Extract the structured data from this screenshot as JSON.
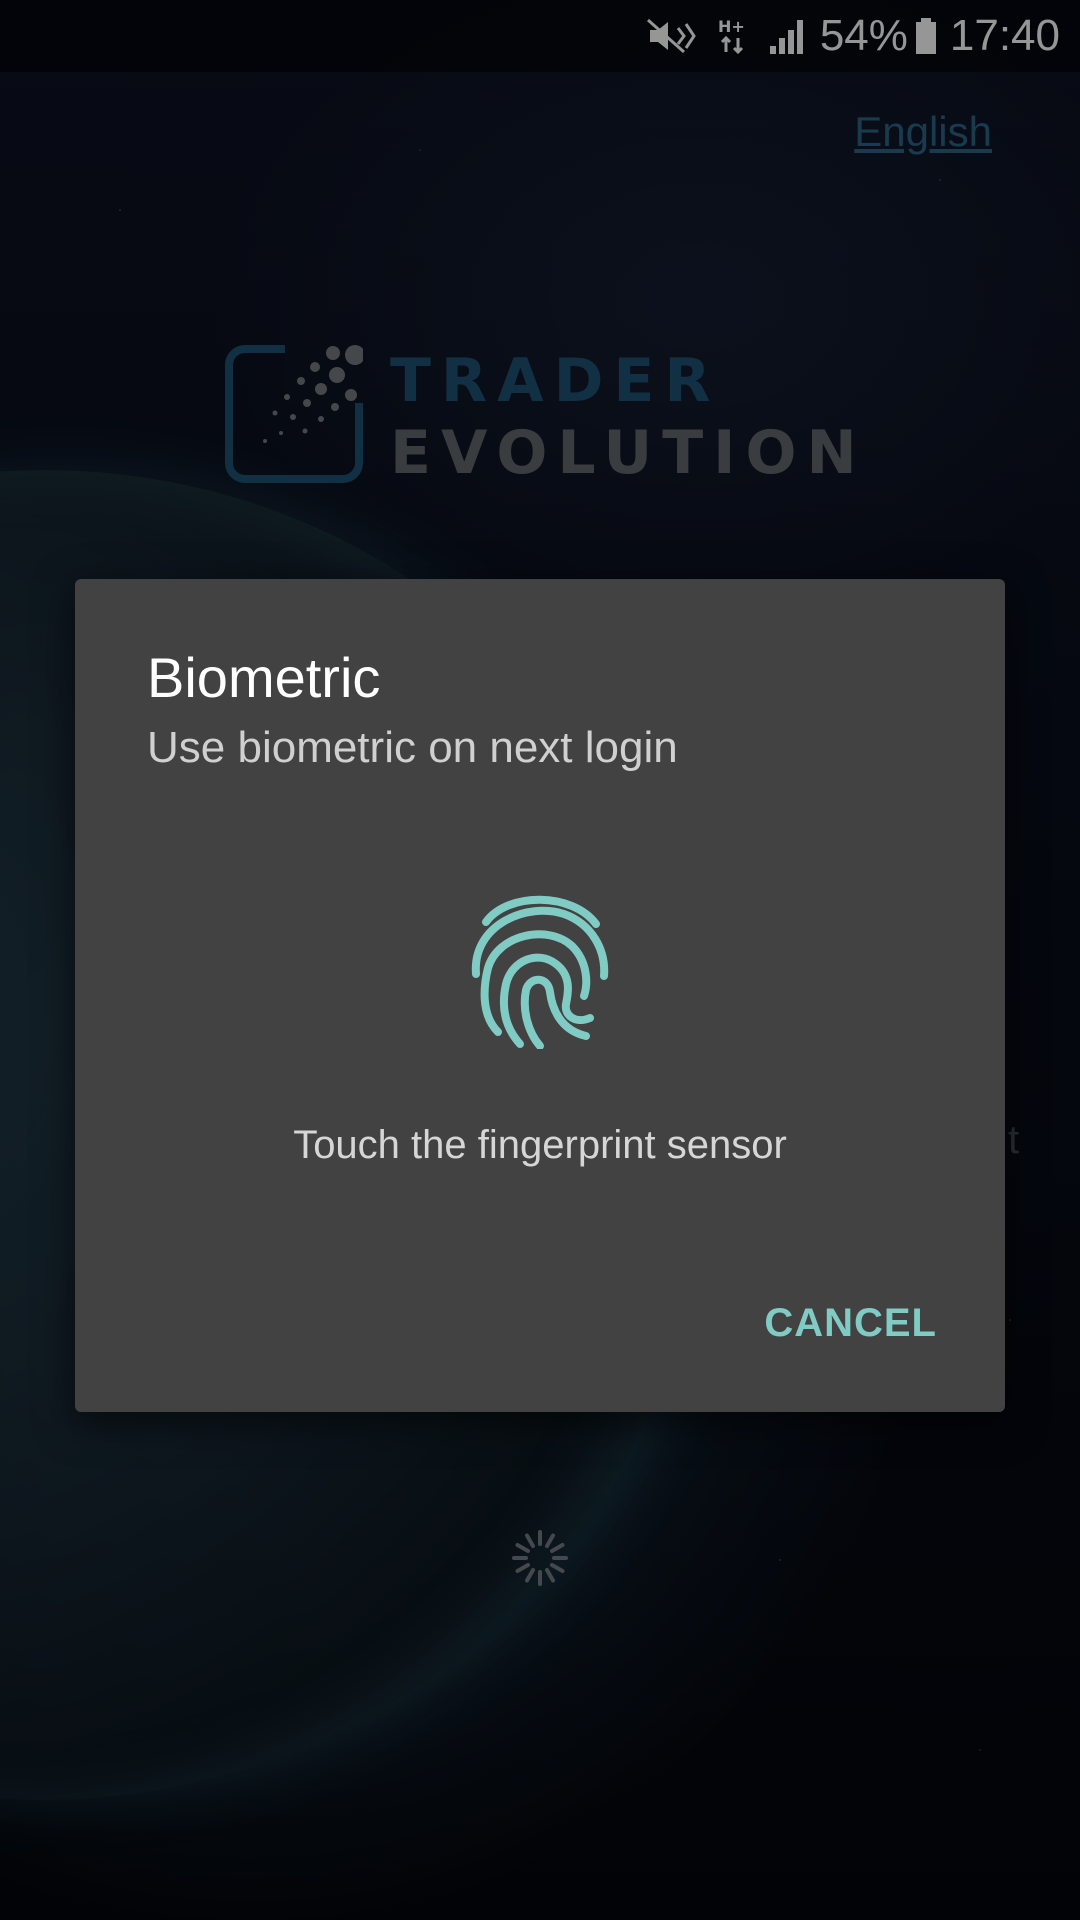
{
  "status_bar": {
    "battery": "54%",
    "time": "17:40",
    "icons": [
      "mute-icon",
      "network-hplus-icon",
      "signal-icon",
      "battery-icon"
    ]
  },
  "header": {
    "language": "English"
  },
  "logo": {
    "line1": "TRADER",
    "line2": "EVOLUTION"
  },
  "background_fragments": {
    "right_text": "t"
  },
  "dialog": {
    "title": "Biometric",
    "subtitle": "Use biometric on next login",
    "icon": "fingerprint-icon",
    "hint": "Touch the fingerprint sensor",
    "cancel_label": "CANCEL",
    "accent_color": "#80cbc4",
    "background_color": "#424242"
  },
  "colors": {
    "language_link": "#285a78",
    "logo_primary": "#1d4a68",
    "logo_secondary": "#5a5f63"
  }
}
